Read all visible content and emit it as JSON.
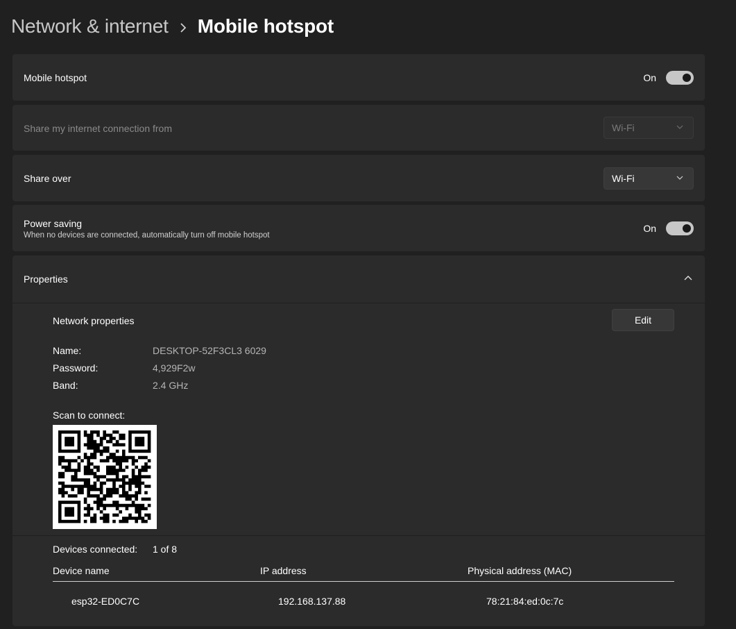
{
  "breadcrumb": {
    "parent": "Network & internet",
    "current": "Mobile hotspot",
    "separator_icon": "chevron-right-icon"
  },
  "hotspot": {
    "label": "Mobile hotspot",
    "state_text": "On",
    "enabled": true
  },
  "share_from": {
    "label": "Share my internet connection from",
    "value": "Wi-Fi",
    "disabled": true
  },
  "share_over": {
    "label": "Share over",
    "value": "Wi-Fi"
  },
  "power_saving": {
    "label": "Power saving",
    "description": "When no devices are connected, automatically turn off mobile hotspot",
    "state_text": "On",
    "enabled": true
  },
  "properties": {
    "label": "Properties",
    "expanded": true,
    "network_properties_label": "Network properties",
    "edit_label": "Edit",
    "name_label": "Name:",
    "name_value": "DESKTOP-52F3CL3 6029",
    "password_label": "Password:",
    "password_value": "4,929F2w",
    "band_label": "Band:",
    "band_value": "2.4 GHz",
    "scan_label": "Scan to connect:",
    "devices_connected_label": "Devices connected:",
    "devices_connected_value": "1 of 8",
    "columns": [
      "Device name",
      "IP address",
      "Physical address (MAC)"
    ],
    "devices": [
      [
        "esp32-ED0C7C",
        "192.168.137.88",
        "78:21:84:ed:0c:7c"
      ]
    ]
  },
  "colors": {
    "background": "#202020",
    "card": "#2b2b2b",
    "toggle_on": "#c7c7c7"
  }
}
